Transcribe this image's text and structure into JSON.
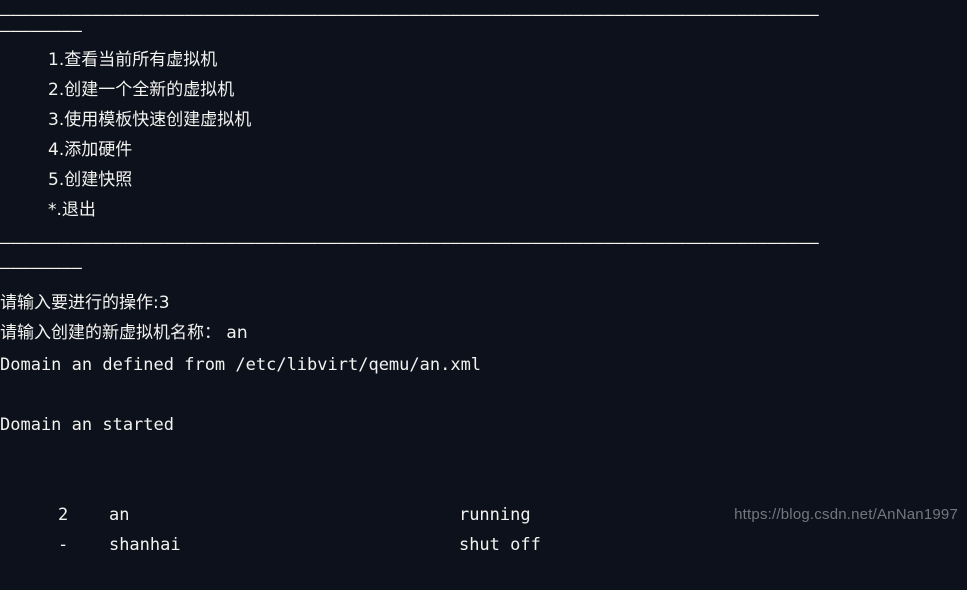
{
  "terminal": {
    "background_color": "#0d111b",
    "text_color": "#f2f2ef",
    "separator_char": "—",
    "rule_full": "————————————————————————————————————————————————————————————————————————————————",
    "rule_short": "————————",
    "menu": {
      "items": [
        {
          "key": "1",
          "label": "1.查看当前所有虚拟机"
        },
        {
          "key": "2",
          "label": "2.创建一个全新的虚拟机"
        },
        {
          "key": "3",
          "label": "3.使用模板快速创建虚拟机"
        },
        {
          "key": "4",
          "label": "4.添加硬件"
        },
        {
          "key": "5",
          "label": "5.创建快照"
        },
        {
          "key": "*",
          "label": "*.退出"
        }
      ]
    },
    "prompts": {
      "operation": "请输入要进行的操作:3",
      "vm_name": "请输入创建的新虚拟机名称： an"
    },
    "output": {
      "defined": "Domain an defined from /etc/libvirt/qemu/an.xml",
      "started": "Domain an started"
    },
    "vm_list": {
      "rows": [
        {
          "id": "2",
          "name": "an",
          "state": "running"
        },
        {
          "id": "-",
          "name": "shanhai",
          "state": "shut off"
        }
      ]
    }
  },
  "watermark": {
    "text": "https://blog.csdn.net/AnNan1997",
    "color": "#72777f"
  }
}
